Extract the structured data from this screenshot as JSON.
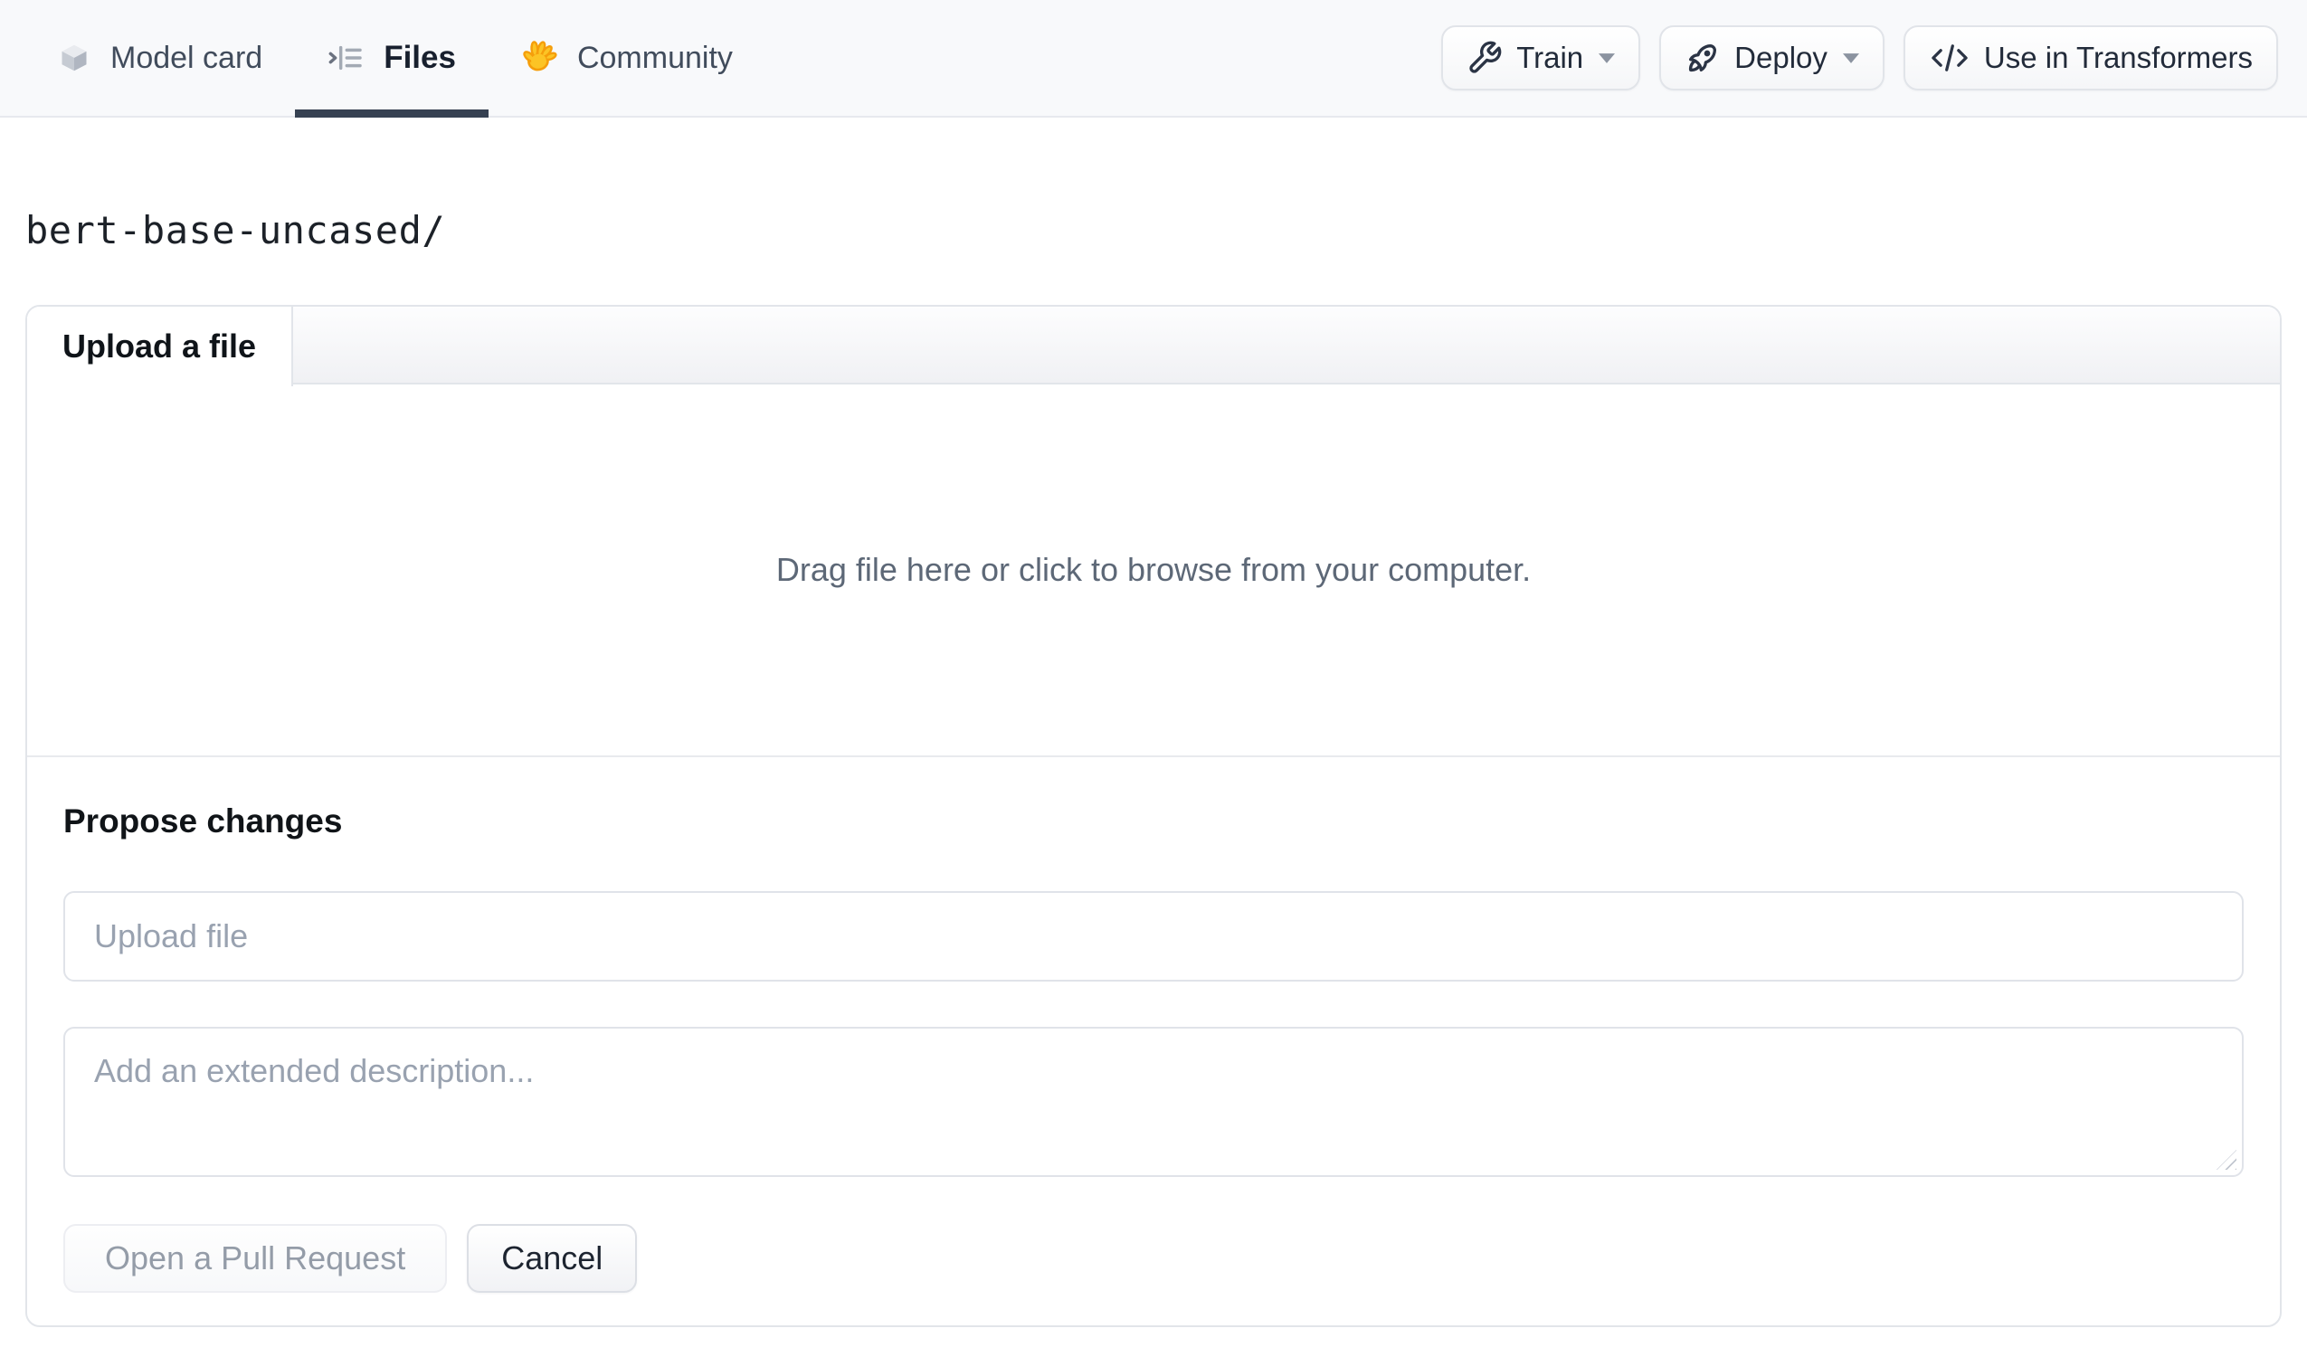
{
  "header": {
    "tabs": [
      {
        "label": "Model card",
        "icon": "cube-icon",
        "active": false
      },
      {
        "label": "Files",
        "icon": "files-list-icon",
        "active": true
      },
      {
        "label": "Community",
        "icon": "waving-hand-icon",
        "active": false
      }
    ],
    "actions": [
      {
        "label": "Train",
        "icon": "wrench-icon",
        "has_dropdown": true
      },
      {
        "label": "Deploy",
        "icon": "rocket-icon",
        "has_dropdown": true
      },
      {
        "label": "Use in Transformers",
        "icon": "code-icon",
        "has_dropdown": false
      }
    ]
  },
  "breadcrumb": {
    "path": "bert-base-uncased/"
  },
  "upload_panel": {
    "tab_label": "Upload a file",
    "dropzone_text": "Drag file here or click to browse from your computer.",
    "propose": {
      "heading": "Propose changes",
      "file_input_placeholder": "Upload file",
      "description_placeholder": "Add an extended description...",
      "primary_button": "Open a Pull Request",
      "cancel_button": "Cancel"
    }
  },
  "colors": {
    "header_bg": "#f8f9fb",
    "active_tab_underline": "#364152",
    "border": "#e2e5ea",
    "muted_text": "#5d6877",
    "placeholder_text": "#99a2b0",
    "disabled_button_text": "#949ca8",
    "emoji_yellow": "#fcc425",
    "emoji_orange": "#f59e0b"
  }
}
